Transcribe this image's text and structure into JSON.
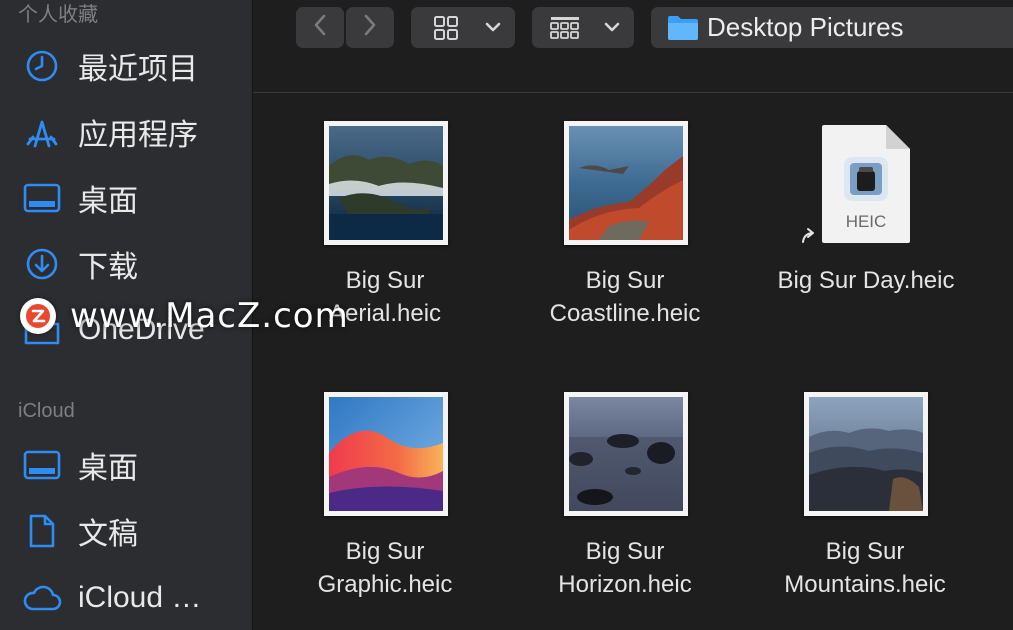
{
  "sidebar": {
    "favorites_title": "个人收藏",
    "favorites": [
      {
        "label": "最近项目",
        "icon": "clock-icon"
      },
      {
        "label": "应用程序",
        "icon": "applications-icon"
      },
      {
        "label": "桌面",
        "icon": "desktop-icon"
      },
      {
        "label": "下载",
        "icon": "download-icon"
      },
      {
        "label": "OneDrive",
        "icon": "folder-icon"
      }
    ],
    "icloud_title": "iCloud",
    "icloud": [
      {
        "label": "桌面",
        "icon": "desktop-icon"
      },
      {
        "label": "文稿",
        "icon": "document-icon"
      },
      {
        "label": "iCloud …",
        "icon": "cloud-icon"
      }
    ]
  },
  "toolbar": {
    "path_label": "Desktop Pictures"
  },
  "files": [
    {
      "line1": "Big Sur",
      "line2": "Aerial.heic"
    },
    {
      "line1": "Big Sur",
      "line2": "Coastline.heic"
    },
    {
      "line1": "Big Sur Day.heic",
      "line2": ""
    },
    {
      "line1": "Big Sur",
      "line2": "Graphic.heic"
    },
    {
      "line1": "Big Sur",
      "line2": "Horizon.heic"
    },
    {
      "line1": "Big Sur",
      "line2": "Mountains.heic"
    }
  ],
  "heic_badge": "HEIC",
  "watermark": "www.MacZ.com",
  "colors": {
    "accent": "#2f8cf2"
  }
}
